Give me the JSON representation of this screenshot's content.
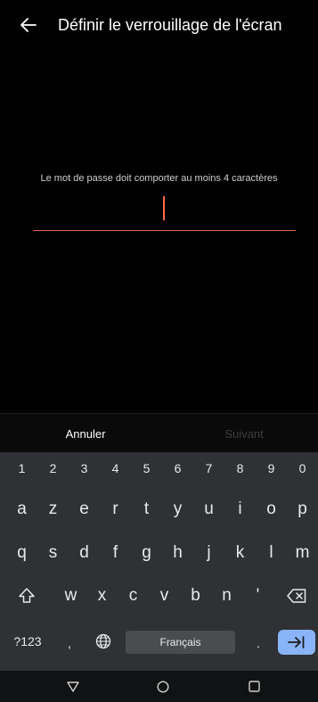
{
  "header": {
    "title": "Définir le verrouillage de l'écran"
  },
  "password": {
    "hint": "Le mot de passe doit comporter au moins 4 caractères",
    "value": ""
  },
  "actions": {
    "cancel_label": "Annuler",
    "next_label": "Suivant"
  },
  "keyboard": {
    "digits": [
      "1",
      "2",
      "3",
      "4",
      "5",
      "6",
      "7",
      "8",
      "9",
      "0"
    ],
    "row1": [
      "a",
      "z",
      "e",
      "r",
      "t",
      "y",
      "u",
      "i",
      "o",
      "p"
    ],
    "row2": [
      "q",
      "s",
      "d",
      "f",
      "g",
      "h",
      "j",
      "k",
      "l",
      "m"
    ],
    "row3": [
      "w",
      "x",
      "c",
      "v",
      "b",
      "n",
      "'"
    ],
    "symbols_label": "?123",
    "comma_label": ",",
    "period_label": ".",
    "space_label": "Français"
  },
  "colors": {
    "accent": "#ff6b47",
    "enter_key": "#8ab4f8",
    "keyboard_bg": "#2f3135"
  }
}
